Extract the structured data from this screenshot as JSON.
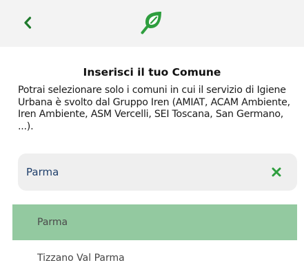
{
  "header": {
    "back_icon": "chevron-left-icon",
    "logo_icon": "leaf-logo-icon"
  },
  "page": {
    "title": "Inserisci il tuo Comune",
    "description": "Potrai selezionare solo i comuni in cui il servizio di Igiene Urbana è svolto dal Gruppo Iren (AMIAT, ACAM Ambiente, Iren Ambiente, ASM Vercelli, SEI Toscana, San Germano, ...)."
  },
  "search": {
    "value": "Parma",
    "clear_icon": "close-icon"
  },
  "results": [
    {
      "label": "Parma",
      "selected": true
    },
    {
      "label": "Tizzano Val Parma",
      "selected": false
    }
  ],
  "colors": {
    "accent_green": "#2e9e3e",
    "selected_bg": "#93c9a0",
    "header_bg": "#f3f3f3",
    "input_text": "#1f3f6b"
  }
}
